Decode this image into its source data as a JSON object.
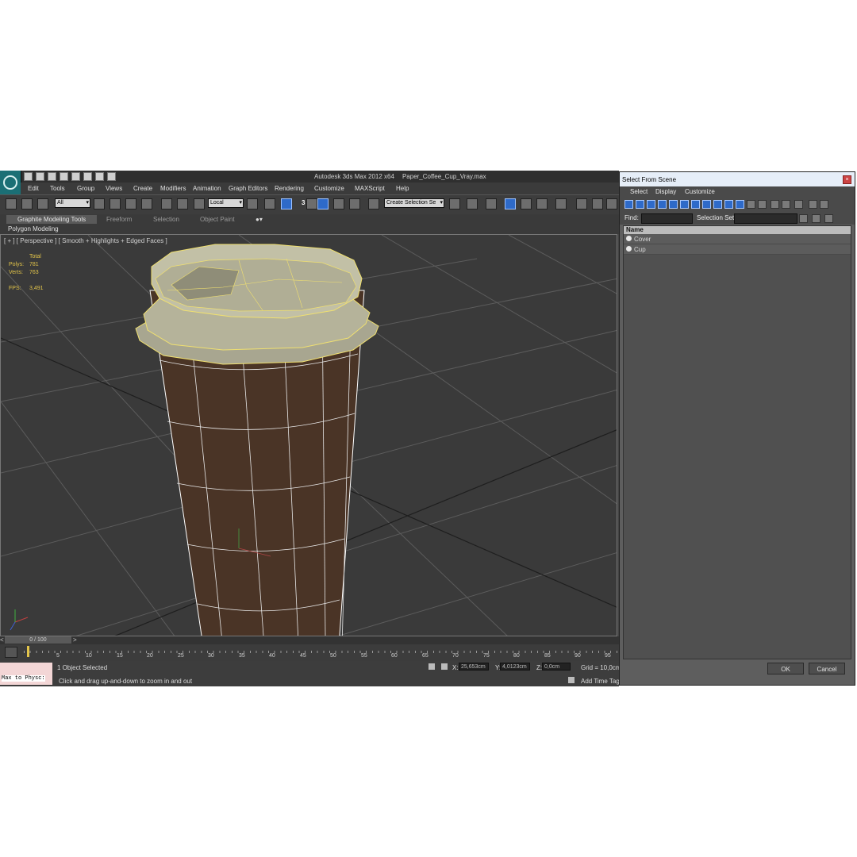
{
  "window": {
    "app_title": "Autodesk 3ds Max  2012 x64",
    "file_name": "Paper_Coffee_Cup_Vray.max"
  },
  "menu": [
    "Edit",
    "Tools",
    "Group",
    "Views",
    "Create",
    "Modifiers",
    "Animation",
    "Graph Editors",
    "Rendering",
    "Customize",
    "MAXScript",
    "Help"
  ],
  "toolbar": {
    "selection_filter": "All",
    "reference_coord": "Local",
    "named_selection": "Create Selection Se",
    "angle_snap_label": "3"
  },
  "ribbon": {
    "tabs": [
      "Graphite Modeling Tools",
      "Freeform",
      "Selection",
      "Object Paint"
    ],
    "active_panel": "Polygon Modeling"
  },
  "viewport": {
    "label": "[ + ] [ Perspective ] [ Smooth + Highlights + Edged Faces ]",
    "stats": {
      "header": "Total",
      "polys_label": "Polys:",
      "polys": "781",
      "verts_label": "Verts:",
      "verts": "763",
      "fps_label": "FPS:",
      "fps": "3,491"
    },
    "colors": {
      "cup": "#4a3426",
      "lid": "#b5b39a",
      "selection": "#f0e070",
      "grid": "#5a5a5a"
    }
  },
  "timeline": {
    "frame_display": "0 / 100",
    "ticks": [
      "5",
      "10",
      "15",
      "20",
      "25",
      "30",
      "35",
      "40",
      "45",
      "50",
      "55",
      "60",
      "65",
      "70",
      "75",
      "80",
      "85",
      "90",
      "95"
    ]
  },
  "status": {
    "maxscript": "Max to Physc:",
    "selection": "1 Object Selected",
    "prompt": "Click and drag up-and-down to zoom in and out",
    "x_label": "X:",
    "x": "25,653cm",
    "y_label": "Y:",
    "y": "4,0123cm",
    "z_label": "Z:",
    "z": "0,0cm",
    "grid": "Grid = 10,0cm",
    "add_time_tag": "Add Time Tag"
  },
  "dialog": {
    "title": "Select From Scene",
    "menu": [
      "Select",
      "Display",
      "Customize"
    ],
    "find_label": "Find:",
    "selection_set_label": "Selection Set:",
    "column_name": "Name",
    "items": [
      "Cover",
      "Cup"
    ],
    "ok": "OK",
    "cancel": "Cancel"
  }
}
